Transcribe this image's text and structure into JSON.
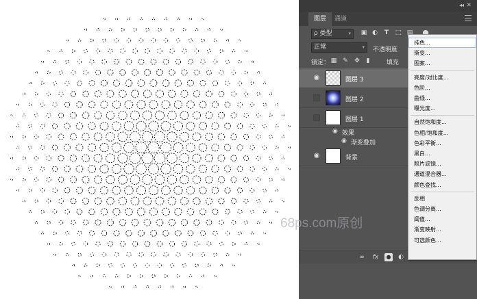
{
  "panel": {
    "tabs": [
      {
        "label": "图层",
        "active": true
      },
      {
        "label": "通道",
        "active": false
      }
    ],
    "filter": {
      "kind": "ρ 类型",
      "icons": [
        "image-filter-icon",
        "adjustment-filter-icon",
        "type-filter-icon",
        "shape-filter-icon",
        "smart-object-filter-icon",
        "filter-toggle-icon"
      ]
    },
    "blend_mode": "正常",
    "opacity_label": "不透明度",
    "lock_label": "锁定：",
    "fill_label": "填充",
    "layers": [
      {
        "name": "图层 3",
        "visible": true,
        "selected": true,
        "thumbnail": "transparent-checker"
      },
      {
        "name": "图层 2",
        "visible": false,
        "selected": false,
        "thumbnail": "radial-gradient"
      },
      {
        "name": "图层 1",
        "visible": false,
        "selected": false,
        "thumbnail": "white"
      },
      {
        "name": "背景",
        "visible": true,
        "selected": false,
        "thumbnail": "white"
      }
    ],
    "effects": {
      "group_label": "效果",
      "item_label": "渐变叠加"
    },
    "bottom": {
      "fx_label": "fx"
    }
  },
  "context_menu": {
    "items": [
      {
        "label": "纯色...",
        "highlighted": true
      },
      {
        "label": "渐变..."
      },
      {
        "label": "图案..."
      },
      {
        "separator": true
      },
      {
        "label": "亮度/对比度..."
      },
      {
        "label": "色阶..."
      },
      {
        "label": "曲线..."
      },
      {
        "label": "曝光度..."
      },
      {
        "separator": true
      },
      {
        "label": "自然饱和度..."
      },
      {
        "label": "色相/饱和度..."
      },
      {
        "label": "色彩平衡..."
      },
      {
        "label": "黑白..."
      },
      {
        "label": "照片滤镜..."
      },
      {
        "label": "通道混合器..."
      },
      {
        "label": "颜色查找..."
      },
      {
        "separator": true
      },
      {
        "label": "反相"
      },
      {
        "label": "色调分离..."
      },
      {
        "label": "阈值..."
      },
      {
        "label": "渐变映射..."
      },
      {
        "label": "可选颜色..."
      }
    ]
  },
  "watermark": "68ps.com原创",
  "colors": {
    "panel_bg": "#535353",
    "selected_row": "#6d6d6d",
    "menu_bg": "#f0f0f0",
    "canvas_bg": "#ffffff"
  }
}
